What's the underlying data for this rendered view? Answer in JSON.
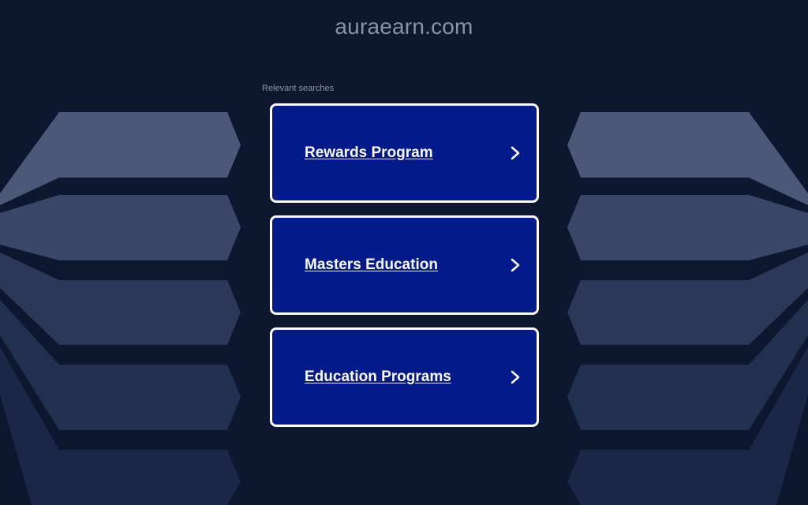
{
  "site": {
    "domain": "auraearn.com"
  },
  "searches": {
    "label": "Relevant searches",
    "items": [
      {
        "label": "Rewards Program",
        "icon": "chevron-right-icon"
      },
      {
        "label": "Masters Education",
        "icon": "chevron-right-icon"
      },
      {
        "label": "Education Programs",
        "icon": "chevron-right-icon"
      }
    ]
  },
  "colors": {
    "background": "#0e1730",
    "card": "#021a8a",
    "card_border": "#ffffff",
    "text_muted": "#8a91a8",
    "decoration_light": "#4b5878",
    "decoration_mid": "#344262",
    "decoration_dark": "#1c2846"
  }
}
